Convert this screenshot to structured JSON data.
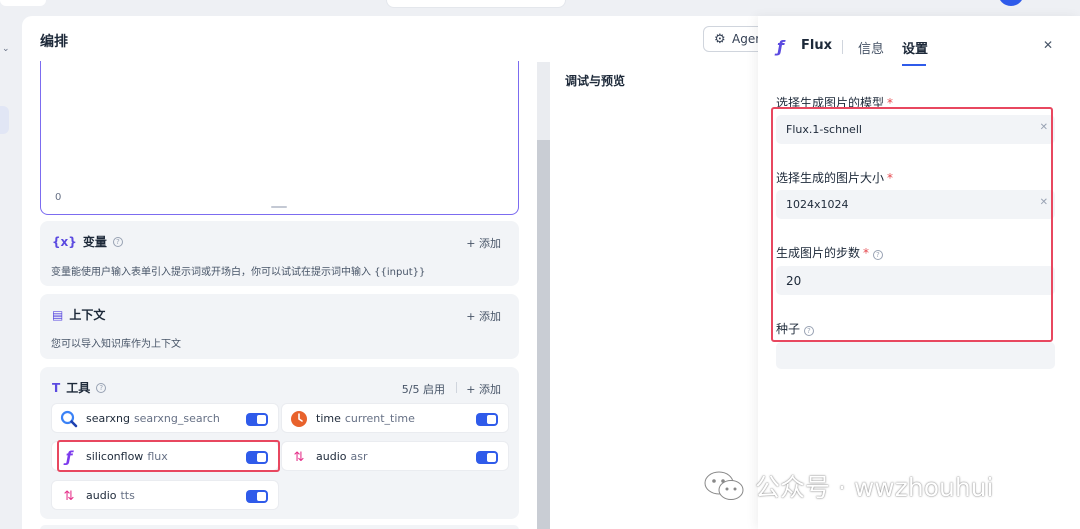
{
  "workspace": {
    "title": "编排",
    "agent_button": "Agent",
    "prompt_char_count": "0"
  },
  "variables": {
    "title": "变量",
    "add": "+ 添加",
    "description": "变量能使用户输入表单引入提示词或开场白，你可以试试在提示词中输入 {{input}}"
  },
  "context": {
    "title": "上下文",
    "add": "+ 添加",
    "description": "您可以导入知识库作为上下文"
  },
  "tools": {
    "title": "工具",
    "count": "5/5 启用",
    "add": "+ 添加",
    "items": [
      {
        "name": "searxng",
        "sub": "searxng_search",
        "icon": "search-icon",
        "enabled": true
      },
      {
        "name": "time",
        "sub": "current_time",
        "icon": "clock-icon",
        "enabled": true
      },
      {
        "name": "siliconflow",
        "sub": "flux",
        "icon": "siliconflow-logo-icon",
        "enabled": true
      },
      {
        "name": "audio",
        "sub": "asr",
        "icon": "audio-icon",
        "enabled": true
      },
      {
        "name": "audio",
        "sub": "tts",
        "icon": "audio-icon",
        "enabled": true
      }
    ]
  },
  "preview": {
    "title": "调试与预览"
  },
  "panel": {
    "title": "Flux",
    "tabs": [
      "信息",
      "设置"
    ],
    "active_tab": "设置",
    "fields": [
      {
        "label": "选择生成图片的模型",
        "required": true,
        "value": "Flux.1-schnell",
        "clearable": true
      },
      {
        "label": "选择生成的图片大小",
        "required": true,
        "value": "1024x1024",
        "clearable": true
      },
      {
        "label": "生成图片的步数",
        "required": true,
        "help": true,
        "value": "20"
      },
      {
        "label": "种子",
        "help": true,
        "value": ""
      }
    ]
  },
  "watermark": {
    "text": "公众号 · wwzhouhui"
  },
  "colors": {
    "accent": "#2f5bea",
    "brand_purple": "#5b4ae0",
    "highlight_red": "#e8475f",
    "required": "#e5484d"
  }
}
